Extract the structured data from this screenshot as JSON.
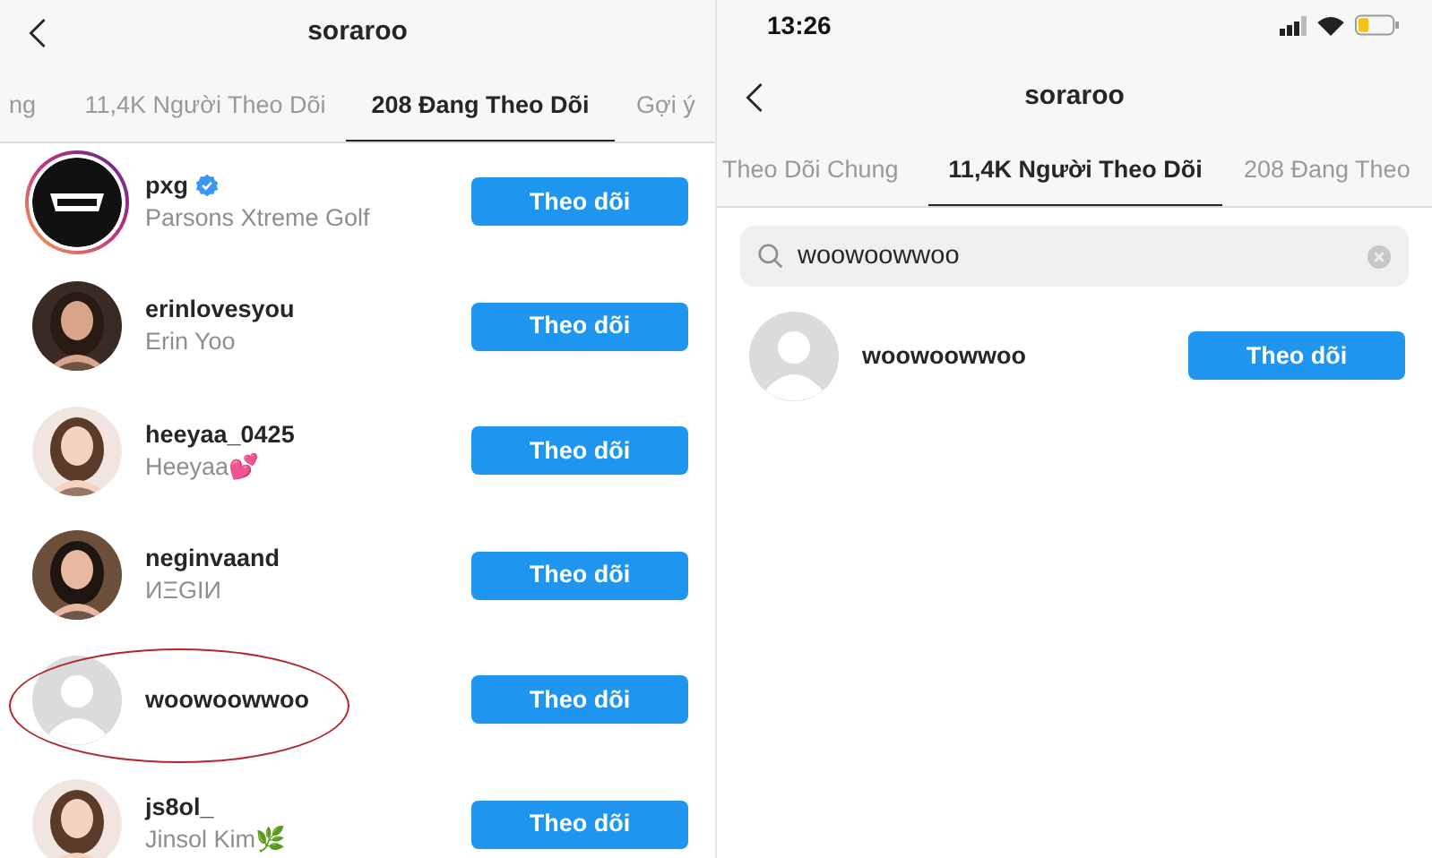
{
  "left_screen": {
    "header": {
      "title": "soraroo"
    },
    "tabs": [
      {
        "label": "ng",
        "selected": false
      },
      {
        "label": "11,4K Người Theo Dõi",
        "selected": false
      },
      {
        "label": "208 Đang Theo Dõi",
        "selected": true
      },
      {
        "label": "Gợi ý",
        "selected": false
      }
    ],
    "rows": [
      {
        "kind": "logo",
        "story_ring": true,
        "username": "pxg",
        "verified": true,
        "full_name": "Parsons Xtreme Golf",
        "button": "Theo dõi",
        "highlighted": false
      },
      {
        "kind": "picture",
        "story_ring": false,
        "username": "erinlovesyou",
        "verified": false,
        "full_name": "Erin Yoo",
        "button": "Theo dõi",
        "highlighted": false
      },
      {
        "kind": "picture",
        "story_ring": false,
        "username": "heeyaa_0425",
        "verified": false,
        "full_name": "Heeyaa💕",
        "button": "Theo dõi",
        "highlighted": false
      },
      {
        "kind": "picture",
        "story_ring": false,
        "username": "neginvaand",
        "verified": false,
        "full_name": "ИΞGIИ",
        "button": "Theo dõi",
        "highlighted": false
      },
      {
        "kind": "default",
        "story_ring": false,
        "username": "woowoowwoo",
        "verified": false,
        "button": "Theo dõi",
        "highlighted": true
      },
      {
        "kind": "picture",
        "story_ring": false,
        "username": "js8ol_",
        "verified": false,
        "full_name": "Jinsol Kim🌿",
        "button": "Theo dõi",
        "highlighted": false
      }
    ]
  },
  "right_screen": {
    "status_bar": {
      "time": "13:26"
    },
    "header": {
      "title": "soraroo"
    },
    "tabs": [
      {
        "label": "Theo Dõi Chung",
        "selected": false
      },
      {
        "label": "11,4K Người Theo Dõi",
        "selected": true
      },
      {
        "label": "208 Đang Theo",
        "selected": false
      }
    ],
    "search": {
      "value": "woowoowwoo"
    },
    "rows": [
      {
        "kind": "default",
        "story_ring": false,
        "username": "woowoowwoo",
        "verified": false,
        "button": "Theo dõi",
        "highlighted": false
      }
    ]
  }
}
